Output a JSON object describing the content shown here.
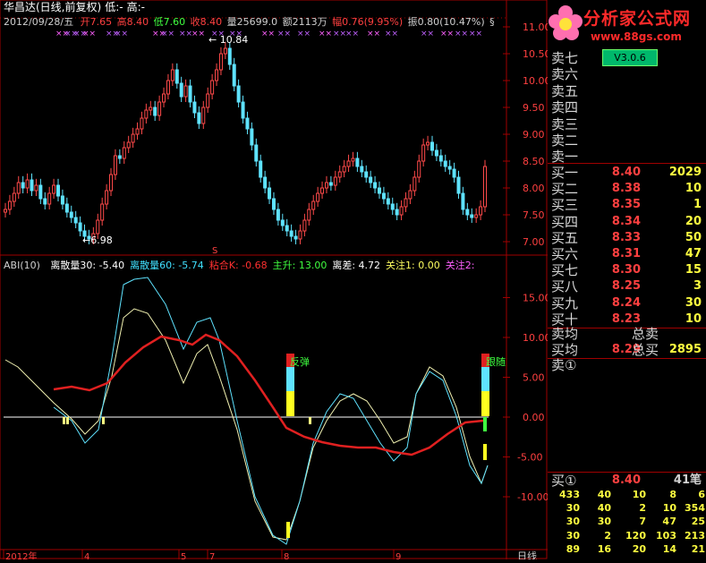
{
  "header": {
    "stock_name": "华昌达(日线,前复权)",
    "low_marker": "低:-",
    "high_marker": "高:-",
    "info_date": "2012/09/28/五",
    "open_label": "开",
    "open": "7.65",
    "high_label": "高",
    "high": "8.40",
    "low_label": "低",
    "low": "7.60",
    "close_label": "收",
    "close": "8.40",
    "vol_label": "量",
    "volume": "25699.0",
    "amt_label": "额",
    "amount": "2113万",
    "chg_label": "幅",
    "change": "0.76(9.95%)",
    "amp_label": "振",
    "amplitude": "0.80(10.47%)",
    "extra": "§"
  },
  "price_axis": [
    "11.00",
    "10.50",
    "10.00",
    "9.50",
    "9.00",
    "8.50",
    "8.00",
    "7.50",
    "7.00"
  ],
  "price_annotations": {
    "high_mark": "10.84",
    "low_mark": "6.98",
    "marker_s": "S"
  },
  "indicator": {
    "name": "ABI(10)",
    "items": [
      {
        "label": "离散量30:",
        "value": "-5.40",
        "color": "#ffffff"
      },
      {
        "label": "离散量60:",
        "value": "-5.74",
        "color": "#40e0ff"
      },
      {
        "label": "粘合K:",
        "value": "-0.68",
        "color": "#ff3030"
      },
      {
        "label": "主升:",
        "value": "13.00",
        "color": "#40ff40"
      },
      {
        "label": "离差:",
        "value": "4.72",
        "color": "#ffffff"
      },
      {
        "label": "关注1:",
        "value": "0.00",
        "color": "#ffff60"
      },
      {
        "label": "关注2:",
        "value": "",
        "color": "#ff60ff"
      }
    ],
    "axis": [
      "15.00",
      "10.00",
      "5.00",
      "0.00",
      "-5.00",
      "-10.00"
    ],
    "signal_labels": [
      "反弹",
      "跟随"
    ]
  },
  "bottom_axis": [
    "2012年",
    "4",
    "5",
    "7",
    "8",
    "9"
  ],
  "bottom_right": "日线",
  "logo": {
    "title": "分析家公式网",
    "url": "www.88gs.com",
    "version": "V3.0.6"
  },
  "orderbook": {
    "sells": [
      {
        "label": "卖七"
      },
      {
        "label": "卖六"
      },
      {
        "label": "卖五"
      },
      {
        "label": "卖四"
      },
      {
        "label": "卖三"
      },
      {
        "label": "卖二"
      },
      {
        "label": "卖一"
      }
    ],
    "buys": [
      {
        "label": "买一",
        "price": "8.40",
        "vol": "2029"
      },
      {
        "label": "买二",
        "price": "8.38",
        "vol": "10"
      },
      {
        "label": "买三",
        "price": "8.35",
        "vol": "1"
      },
      {
        "label": "买四",
        "price": "8.34",
        "vol": "20"
      },
      {
        "label": "买五",
        "price": "8.33",
        "vol": "50"
      },
      {
        "label": "买六",
        "price": "8.31",
        "vol": "47"
      },
      {
        "label": "买七",
        "price": "8.30",
        "vol": "15"
      },
      {
        "label": "买八",
        "price": "8.25",
        "vol": "3"
      },
      {
        "label": "买九",
        "price": "8.24",
        "vol": "30"
      },
      {
        "label": "买十",
        "price": "8.23",
        "vol": "10"
      }
    ],
    "sell_avg_label": "卖均",
    "sell_total_label": "总卖",
    "buy_avg_label": "买均",
    "buy_avg": "8.29",
    "buy_total_label": "总买",
    "buy_total": "2895",
    "sell_queue_label": "卖①",
    "buy_queue_label": "买①",
    "buy_queue_price": "8.40",
    "buy_queue_count": "41笔",
    "queue_rows": [
      [
        "433",
        "40",
        "10",
        "8",
        "6"
      ],
      [
        "30",
        "40",
        "2",
        "10",
        "354"
      ],
      [
        "30",
        "30",
        "7",
        "7",
        "4",
        "25"
      ],
      [
        "30",
        "2",
        "120",
        "103",
        "213"
      ],
      [
        "89",
        "16",
        "20",
        "14",
        "21"
      ]
    ]
  }
}
